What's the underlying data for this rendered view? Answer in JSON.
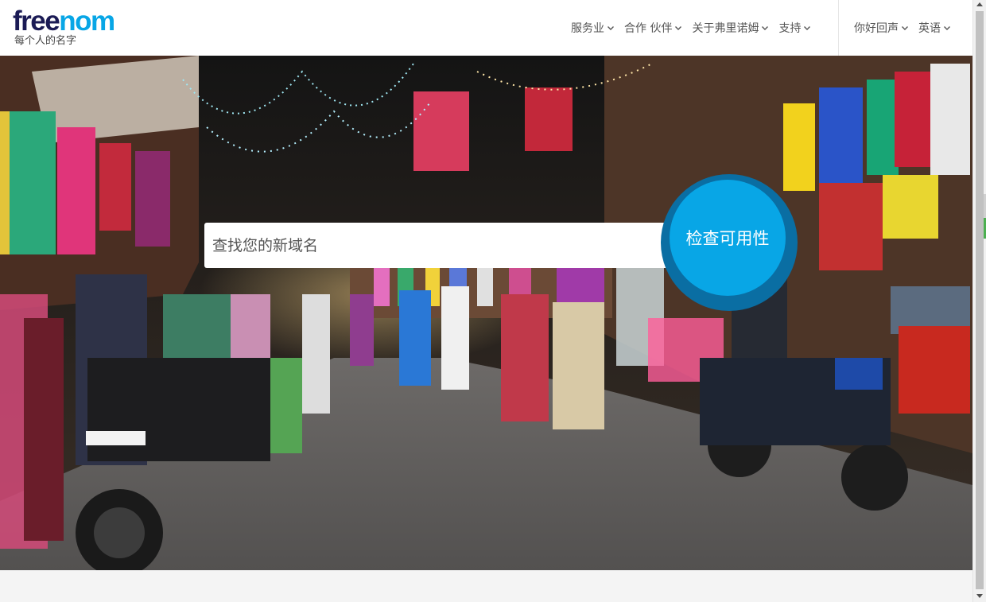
{
  "logo": {
    "part1": "free",
    "part2": "nom",
    "tagline": "每个人的名字"
  },
  "nav": {
    "main": [
      {
        "label": "服务业"
      },
      {
        "label": "合作 伙伴"
      },
      {
        "label": "关于弗里诺姆"
      },
      {
        "label": "支持"
      }
    ],
    "right": [
      {
        "label": "你好回声"
      },
      {
        "label": "英语"
      }
    ]
  },
  "search": {
    "placeholder": "查找您的新域名",
    "button_label": "检查可用性"
  },
  "colors": {
    "brand_dark": "#1b1b55",
    "brand_accent": "#08a6e6",
    "button_ring": "#0a6ea3"
  },
  "icons": {
    "nav_dropdown": "chevron-down-icon"
  }
}
